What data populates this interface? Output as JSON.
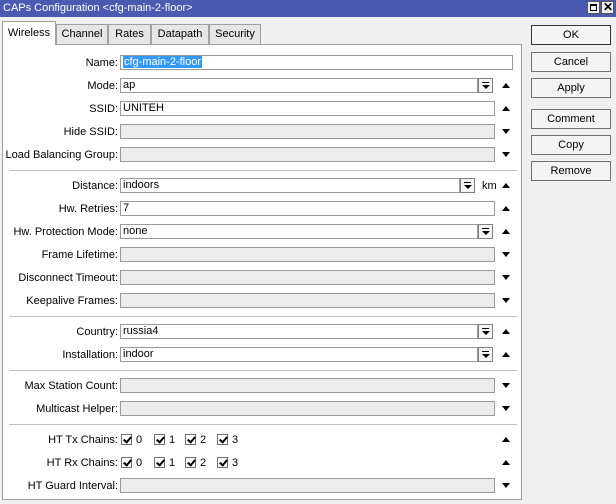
{
  "window": {
    "title": "CAPs Configuration <cfg-main-2-floor>",
    "titlebar_color": "#4a5ab0"
  },
  "tabs": [
    {
      "label": "Wireless",
      "active": true
    },
    {
      "label": "Channel",
      "active": false
    },
    {
      "label": "Rates",
      "active": false
    },
    {
      "label": "Datapath",
      "active": false
    },
    {
      "label": "Security",
      "active": false
    }
  ],
  "fields": {
    "name": {
      "label": "Name:",
      "value": "cfg-main-2-floor"
    },
    "mode": {
      "label": "Mode:",
      "value": "ap"
    },
    "ssid": {
      "label": "SSID:",
      "value": "UNITEH"
    },
    "hide_ssid": {
      "label": "Hide SSID:",
      "value": ""
    },
    "load_balancing_group": {
      "label": "Load Balancing Group:",
      "value": ""
    },
    "distance": {
      "label": "Distance:",
      "value": "indoors",
      "unit": "km"
    },
    "hw_retries": {
      "label": "Hw. Retries:",
      "value": "7"
    },
    "hw_protection_mode": {
      "label": "Hw. Protection Mode:",
      "value": "none"
    },
    "frame_lifetime": {
      "label": "Frame Lifetime:",
      "value": ""
    },
    "disconnect_timeout": {
      "label": "Disconnect Timeout:",
      "value": ""
    },
    "keepalive_frames": {
      "label": "Keepalive Frames:",
      "value": ""
    },
    "country": {
      "label": "Country:",
      "value": "russia4"
    },
    "installation": {
      "label": "Installation:",
      "value": "indoor"
    },
    "max_station_count": {
      "label": "Max Station Count:",
      "value": ""
    },
    "multicast_helper": {
      "label": "Multicast Helper:",
      "value": ""
    },
    "ht_tx_chains": {
      "label": "HT Tx Chains:",
      "chains": [
        "0",
        "1",
        "2",
        "3"
      ]
    },
    "ht_rx_chains": {
      "label": "HT Rx Chains:",
      "chains": [
        "0",
        "1",
        "2",
        "3"
      ]
    },
    "ht_guard_interval": {
      "label": "HT Guard Interval:",
      "value": ""
    }
  },
  "buttons": {
    "ok": "OK",
    "cancel": "Cancel",
    "apply": "Apply",
    "comment": "Comment",
    "copy": "Copy",
    "remove": "Remove"
  },
  "icons": {
    "maximize": "maximize-icon",
    "close": "close-icon",
    "dropdown": "dropdown-icon",
    "expand_up": "arrow-up-icon",
    "expand_down": "arrow-down-icon"
  }
}
